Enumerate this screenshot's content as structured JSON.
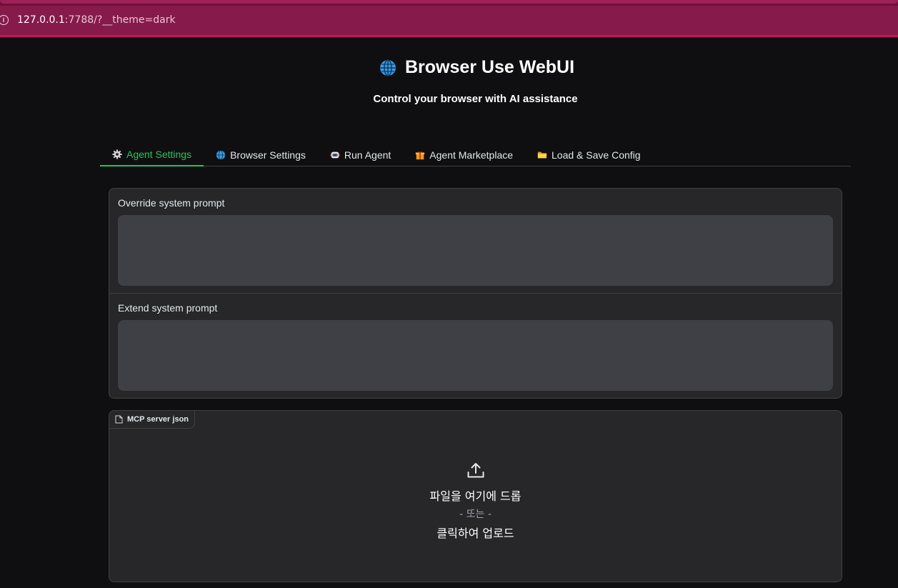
{
  "browser": {
    "url_host": "127.0.0.1",
    "url_rest": ":7788/?__theme=dark"
  },
  "header": {
    "title": "Browser Use WebUI",
    "subtitle": "Control your browser with AI assistance"
  },
  "tabs": [
    {
      "label": "Agent Settings",
      "icon": "gear-icon",
      "active": true
    },
    {
      "label": "Browser Settings",
      "icon": "globe-icon",
      "active": false
    },
    {
      "label": "Run Agent",
      "icon": "robot-icon",
      "active": false
    },
    {
      "label": "Agent Marketplace",
      "icon": "gift-icon",
      "active": false
    },
    {
      "label": "Load & Save Config",
      "icon": "folder-icon",
      "active": false
    }
  ],
  "prompts": {
    "override_label": "Override system prompt",
    "override_value": "",
    "extend_label": "Extend system prompt",
    "extend_value": ""
  },
  "upload": {
    "label": "MCP server json",
    "drop_text": "파일을 여기에 드롭",
    "or_text": "- 또는 -",
    "click_text": "클릭하여 업로드"
  },
  "colors": {
    "accent": "#22c55e",
    "browser_chrome": "#861a4a",
    "background": "#0f0f11",
    "panel": "#27272a"
  }
}
